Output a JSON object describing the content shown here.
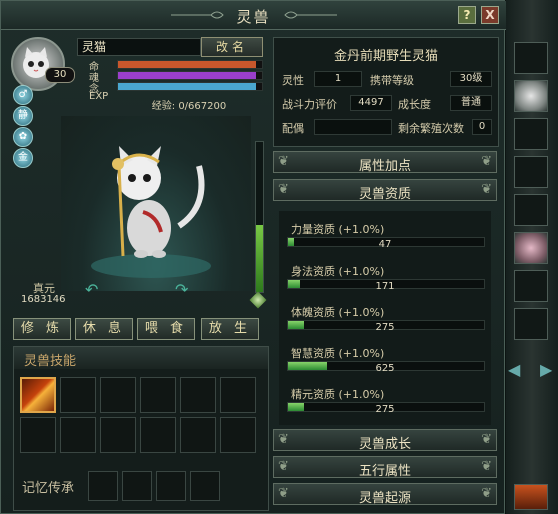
{
  "window": {
    "title": "灵兽",
    "help": "?",
    "close": "X"
  },
  "pet": {
    "level": "30",
    "name": "灵猫",
    "rename_label": "改名",
    "bars": [
      {
        "label": "命",
        "color": "#c8572c",
        "fill": 0.96
      },
      {
        "label": "魂",
        "color": "#9a3fcb",
        "fill": 0.96
      },
      {
        "label": "念",
        "color": "#4aa7cf",
        "fill": 0.96
      },
      {
        "label": "EXP",
        "color": "#444f4b",
        "fill": 0.0
      }
    ],
    "exp_text": "经验: 0/667200",
    "side_icons": [
      {
        "icon": "male-icon",
        "glyph": "♂"
      },
      {
        "icon": "still-icon",
        "glyph": "静"
      },
      {
        "icon": "paw-icon",
        "glyph": "✿"
      },
      {
        "icon": "gold-element-icon",
        "glyph": "金"
      }
    ],
    "zhenyuan_label": "真元",
    "zhenyuan_value": "1683146",
    "zhenyuan_gauge": 0.45,
    "actions": [
      "修 炼",
      "休 息",
      "喂 食",
      "放 生"
    ]
  },
  "skills": {
    "title": "灵兽技能",
    "memory_label": "记忆传承"
  },
  "info": {
    "title": "金丹前期野生灵猫",
    "rows": [
      {
        "label": "灵性",
        "value": "1",
        "label2": "携带等级",
        "value2": "30级"
      },
      {
        "label": "战斗力评价",
        "value": "4497",
        "label2": "成长度",
        "value2": "普通"
      },
      {
        "label": "配偶",
        "value": "",
        "label2": "剩余繁殖次数",
        "value2": "0"
      }
    ]
  },
  "sections": {
    "attr_points": "属性加点",
    "aptitude": "灵兽资质",
    "growth": "灵兽成长",
    "five_elements": "五行属性",
    "origin": "灵兽起源"
  },
  "aptitudes": [
    {
      "label": "力量资质 (+1.0%)",
      "value": "47",
      "fill": 0.03
    },
    {
      "label": "身法资质 (+1.0%)",
      "value": "171",
      "fill": 0.06
    },
    {
      "label": "体魄资质 (+1.0%)",
      "value": "275",
      "fill": 0.08
    },
    {
      "label": "智慧资质 (+1.0%)",
      "value": "625",
      "fill": 0.2
    },
    {
      "label": "精元资质 (+1.0%)",
      "value": "275",
      "fill": 0.08
    }
  ],
  "colors": {
    "accent": "#c9a66b",
    "green": "#2c8b33"
  }
}
